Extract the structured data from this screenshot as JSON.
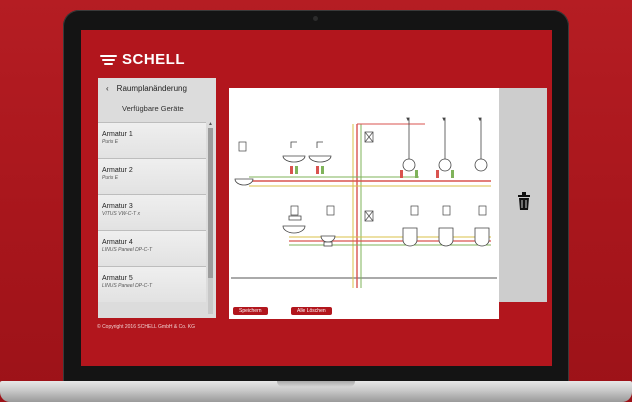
{
  "brand": {
    "logo_text": "SCHELL"
  },
  "sidebar": {
    "back_label": "Raumplanänderung",
    "section_title": "Verfügbare Geräte",
    "items": [
      {
        "name": "Armatur 1",
        "model": "Puris E"
      },
      {
        "name": "Armatur 2",
        "model": "Puris E"
      },
      {
        "name": "Armatur 3",
        "model": "VITUS VW-C-T x"
      },
      {
        "name": "Armatur 4",
        "model": "LINUS Paneel DP-C-T"
      },
      {
        "name": "Armatur 5",
        "model": "LINUS Paneel DP-C-T"
      }
    ]
  },
  "actions": {
    "save_label": "Speichern",
    "clear_label": "Alle Löschen"
  },
  "footer": {
    "copyright": "© Copyright 2016 SCHELL GmbH & Co. KG"
  },
  "colors": {
    "brand_red": "#b2161d",
    "pipe_red": "#d9534f",
    "pipe_green": "#7fb35a",
    "pipe_yellow": "#d8c24a"
  }
}
